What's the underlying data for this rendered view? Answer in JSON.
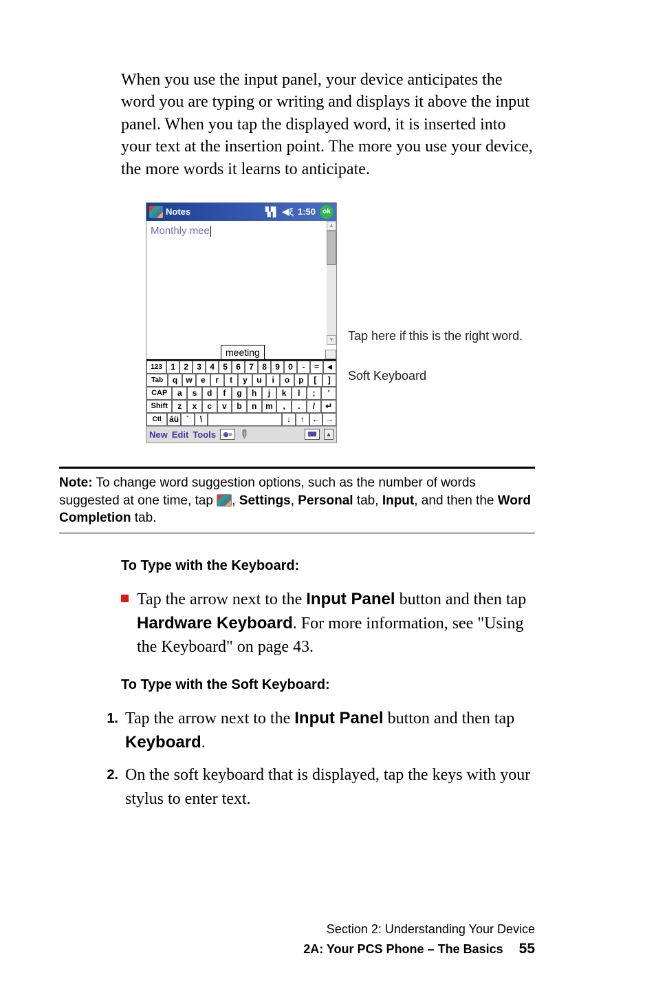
{
  "intro": "When you use the input panel, your device anticipates the word you are typing or writing and displays it above the input panel. When you tap the displayed word, it is inserted into your text at the insertion point. The more you use your device, the more words it learns to anticipate.",
  "device": {
    "title": "Notes",
    "time": "1:50",
    "ok": "ok",
    "typed": "Monthly mee",
    "suggestion": "meeting",
    "keyboard": {
      "row1": [
        "123",
        "1",
        "2",
        "3",
        "4",
        "5",
        "6",
        "7",
        "8",
        "9",
        "0",
        "-",
        "=",
        "◄"
      ],
      "row2": [
        "Tab",
        "q",
        "w",
        "e",
        "r",
        "t",
        "y",
        "u",
        "i",
        "o",
        "p",
        "[",
        "]"
      ],
      "row3": [
        "CAP",
        "a",
        "s",
        "d",
        "f",
        "g",
        "h",
        "j",
        "k",
        "l",
        ";",
        "'"
      ],
      "row4": [
        "Shift",
        "z",
        "x",
        "c",
        "v",
        "b",
        "n",
        "m",
        ",",
        ".",
        "/",
        "↵"
      ],
      "row5": [
        "Ctl",
        "áü",
        "`",
        "\\",
        " ",
        "↓",
        "↑",
        "←",
        "→"
      ]
    },
    "menu": {
      "new": "New",
      "edit": "Edit",
      "tools": "Tools"
    }
  },
  "callouts": {
    "word": "Tap here if this is the right word.",
    "kb": "Soft Keyboard"
  },
  "note": {
    "label": "Note:",
    "text1": " To change word suggestion options, such as the number of words suggested at one time, tap ",
    "comma": ", ",
    "settings": "Settings",
    "personal": "Personal",
    "tab1": " tab, ",
    "input": "Input",
    "andthen": ", and then the ",
    "wc": "Word Completion",
    "tabend": " tab."
  },
  "h1": "To Type with the Keyboard:",
  "bullet": {
    "pre": "Tap the arrow next to the ",
    "ip": "Input Panel",
    "mid": " button and then tap ",
    "hk": "Hardware Keyboard",
    "post": ". For more information, see \"Using the Keyboard\" on page 43."
  },
  "h2": "To Type with the Soft Keyboard:",
  "steps": {
    "s1": {
      "n": "1.",
      "pre": "Tap the arrow next to the ",
      "ip": "Input Panel",
      "mid": " button and then tap ",
      "kb": "Keyboard",
      "end": "."
    },
    "s2": {
      "n": "2.",
      "text": "On the soft keyboard that is displayed, tap the keys with your stylus to enter text."
    }
  },
  "footer": {
    "line1": "Section 2: Understanding Your Device",
    "line2": "2A: Your PCS Phone – The Basics",
    "page": "55"
  }
}
